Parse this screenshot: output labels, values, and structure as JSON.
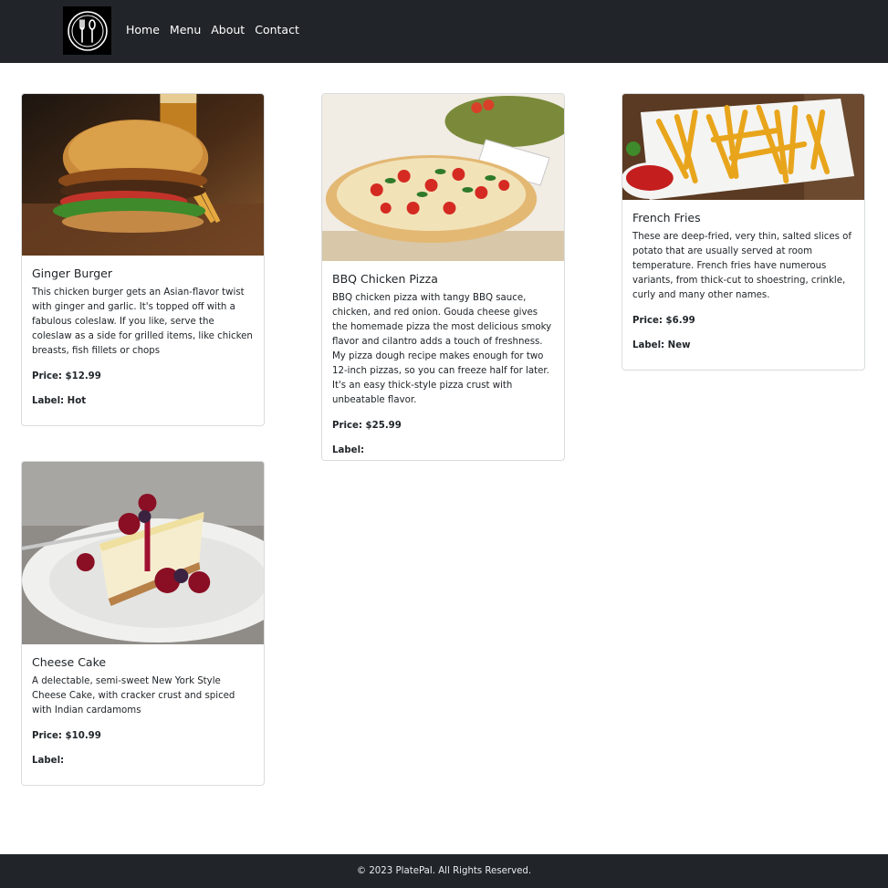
{
  "nav": {
    "logo_icon": "fork-spoon-plate-icon",
    "links": [
      "Home",
      "Menu",
      "About",
      "Contact"
    ]
  },
  "items": [
    {
      "title": "Ginger Burger",
      "description": "This chicken burger gets an Asian-flavor twist with ginger and garlic. It's topped off with a fabulous coleslaw. If you like, serve the coleslaw as a side for grilled items, like chicken breasts, fish fillets or chops",
      "price": "Price: $12.99",
      "label": "Label: Hot",
      "image": "burger-photo"
    },
    {
      "title": "BBQ Chicken Pizza",
      "description": "BBQ chicken pizza with tangy BBQ sauce, chicken, and red onion. Gouda cheese gives the homemade pizza the most delicious smoky flavor and cilantro adds a touch of freshness. My pizza dough recipe makes enough for two 12-inch pizzas, so you can freeze half for later. It's an easy thick-style pizza crust with unbeatable flavor.",
      "price": "Price: $25.99",
      "label": "Label:",
      "image": "pizza-photo"
    },
    {
      "title": "French Fries",
      "description": "These are deep-fried, very thin, salted slices of potato that are usually served at room temperature. French fries have numerous variants, from thick-cut to shoestring, crinkle, curly and many other names.",
      "price": "Price: $6.99",
      "label": "Label: New",
      "image": "fries-photo"
    },
    {
      "title": "Cheese Cake",
      "description": "A delectable, semi-sweet New York Style Cheese Cake, with cracker crust and spiced with Indian cardamoms",
      "price": "Price: $10.99",
      "label": "Label:",
      "image": "cheesecake-photo"
    }
  ],
  "footer": {
    "text": "© 2023 PlatePal. All Rights Reserved."
  }
}
